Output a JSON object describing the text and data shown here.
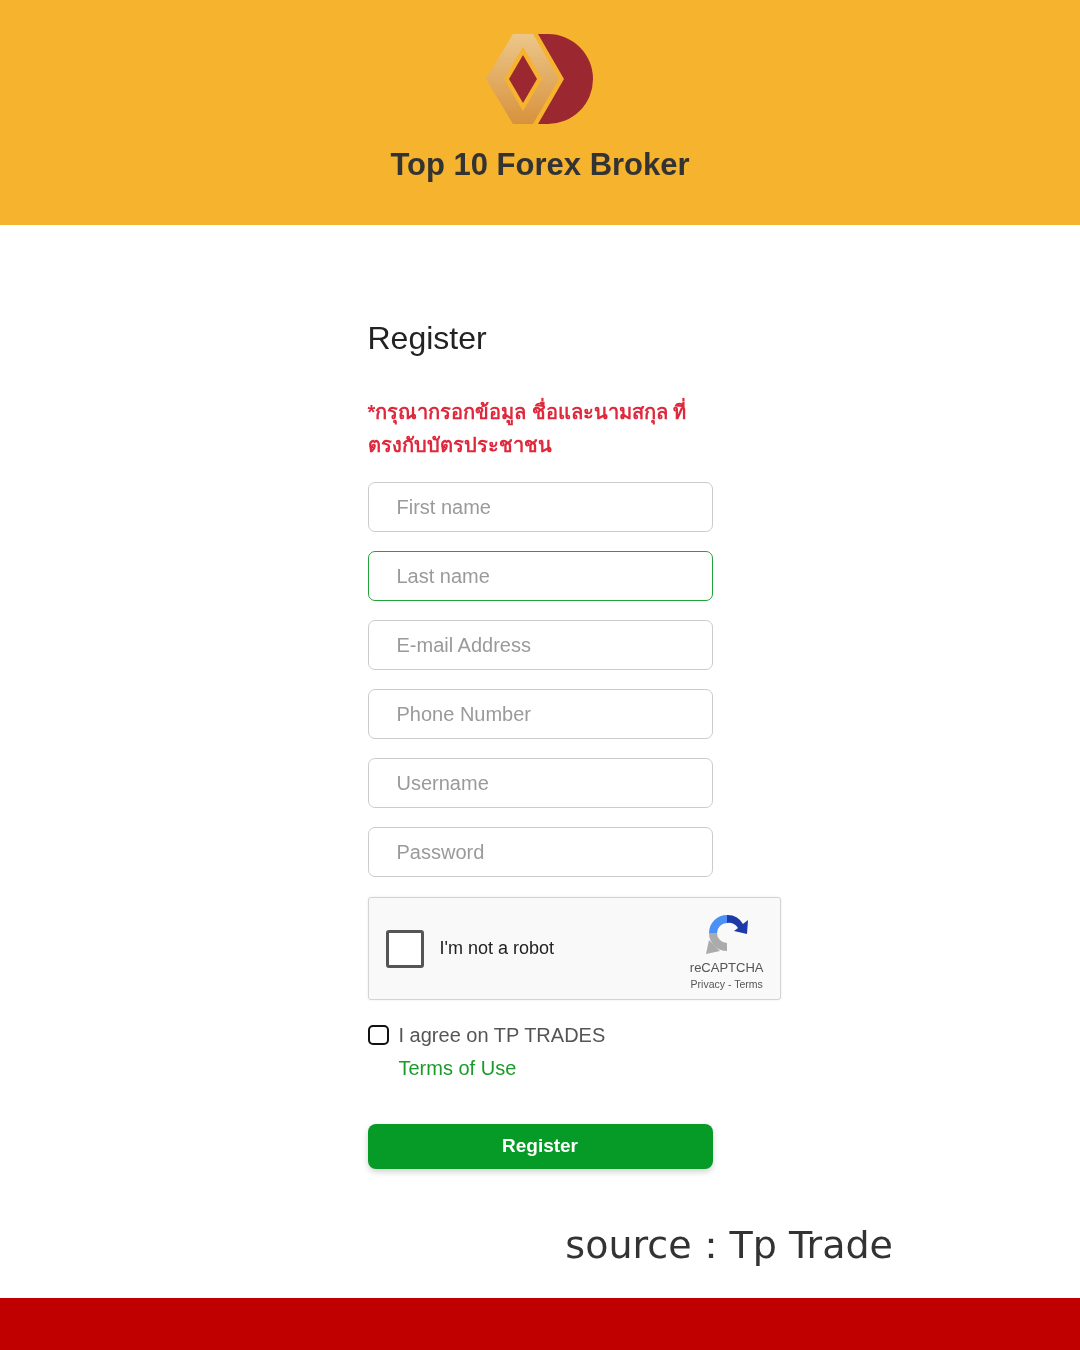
{
  "header": {
    "title": "Top 10 Forex Broker"
  },
  "form": {
    "heading": "Register",
    "notice": "*กรุณากรอกข้อมูล ชื่อและนามสกุล ที่ตรงกับบัตรประชาชน",
    "fields": [
      {
        "placeholder": "First name",
        "focused": false
      },
      {
        "placeholder": "Last name",
        "focused": true
      },
      {
        "placeholder": "E-mail Address",
        "focused": false
      },
      {
        "placeholder": "Phone Number",
        "focused": false
      },
      {
        "placeholder": "Username",
        "focused": false
      },
      {
        "placeholder": "Password",
        "focused": false
      }
    ],
    "captcha": {
      "label": "I'm not a robot",
      "checked": false,
      "brand": "reCAPTCHA",
      "links": "Privacy - Terms"
    },
    "agree": {
      "checked": false,
      "text": "I agree on TP TRADES",
      "link": "Terms of Use"
    },
    "register_button": "Register"
  },
  "source": "source：Tp Trade"
}
